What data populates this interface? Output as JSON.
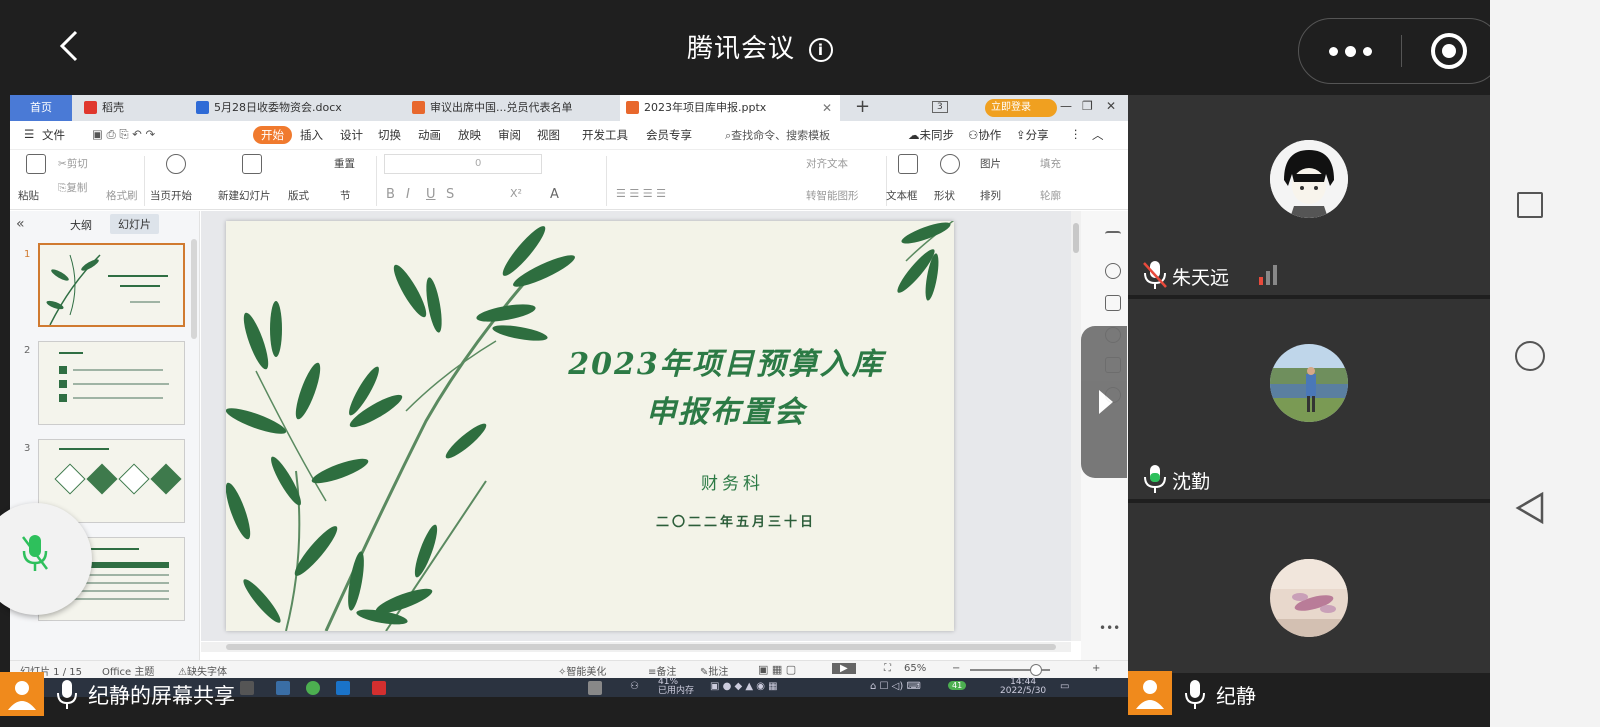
{
  "meeting": {
    "title": "腾讯会议",
    "sharer_label": "纪静的屏幕共享"
  },
  "wps": {
    "tabs": [
      {
        "label": "首页"
      },
      {
        "label": "稻壳"
      },
      {
        "label": "5月28日收委物资会.docx"
      },
      {
        "label": "审议出席中国...兑员代表名单"
      },
      {
        "label": "2023年项目库申报.pptx"
      }
    ],
    "login_label": "立即登录",
    "menus": [
      "文件",
      "开始",
      "插入",
      "设计",
      "切换",
      "动画",
      "放映",
      "审阅",
      "视图",
      "开发工具",
      "会员专享"
    ],
    "search_placeholder": "查找命令、搜索模板",
    "menu_right": [
      "未同步",
      "协作",
      "分享"
    ],
    "ribbon": {
      "paste": "粘贴",
      "cut": "剪切",
      "copy": "复制",
      "format_painter": "格式刷",
      "play_current": "当页开始",
      "new_slide": "新建幻灯片",
      "layout": "版式",
      "section": "节",
      "reset": "重置",
      "font_size": "0",
      "align_text": "对齐文本",
      "smart_graphic": "转智能图形",
      "textbox": "文本框",
      "shape": "形状",
      "picture": "图片",
      "arrange": "排列",
      "fill": "填充",
      "outline": "轮廓"
    },
    "panel": {
      "outline_label": "大纲",
      "slides_label": "幻灯片",
      "slide_numbers": [
        "1",
        "2",
        "3",
        "4"
      ]
    },
    "slide": {
      "title_line1": "2023年项目预算入库",
      "title_line2": "申报布置会",
      "department": "财务科",
      "date": "二〇二二年五月三十日"
    },
    "status": {
      "slide_count": "幻灯片 1 / 15",
      "theme": "Office 主题",
      "missing_font": "缺失字体",
      "smart_beautify": "智能美化",
      "notes": "备注",
      "comments": "批注",
      "zoom": "65%"
    },
    "taskbar": {
      "memory_percent": "41%",
      "memory_label": "已用内存",
      "time": "14:44",
      "date": "2022/5/30",
      "badge": "41"
    }
  },
  "participants": [
    {
      "name": "朱天远",
      "mic": "muted"
    },
    {
      "name": "沈勤",
      "mic": "active"
    },
    {
      "name": "",
      "mic": "none"
    }
  ],
  "self": {
    "name": "纪静"
  },
  "colors": {
    "accent_orange": "#f08a1c",
    "mic_green": "#2ec05c",
    "muted_red": "#e84a3c",
    "slide_green": "#2c7a45"
  }
}
